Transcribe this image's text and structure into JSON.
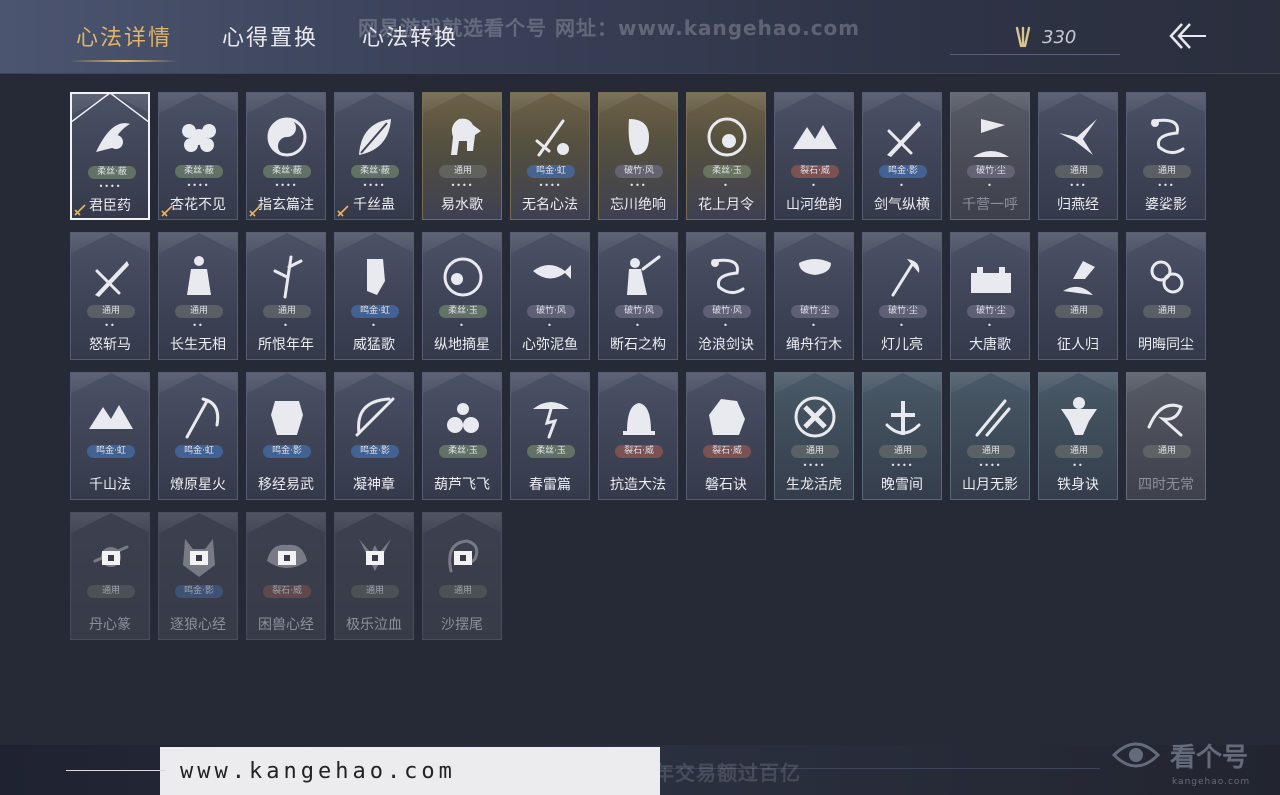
{
  "tabs": [
    {
      "label": "心法详情",
      "active": true
    },
    {
      "label": "心得置换",
      "active": false
    },
    {
      "label": "心法转换",
      "active": false
    }
  ],
  "watermark_top": "网易游戏就选看个号 网址：www.kangehao.com",
  "currency": {
    "icon": "feather-icon",
    "value": "330"
  },
  "back_icon": "back-arrow-icon",
  "cards": [
    {
      "name": "君臣药",
      "tag": "柔丝·蔽",
      "tagClass": "t-roufu",
      "dots": "••••",
      "style": "",
      "selected": true,
      "corner": true,
      "icon": "herb-icon"
    },
    {
      "name": "杏花不见",
      "tag": "柔丝·蔽",
      "tagClass": "t-roufu",
      "dots": "••••",
      "style": "",
      "corner": true,
      "icon": "blossom-icon"
    },
    {
      "name": "指玄篇注",
      "tag": "柔丝·蔽",
      "tagClass": "t-roufu",
      "dots": "••••",
      "style": "",
      "corner": true,
      "icon": "yinyang-icon"
    },
    {
      "name": "千丝蛊",
      "tag": "柔丝·蔽",
      "tagClass": "t-roufu",
      "dots": "••••",
      "style": "",
      "corner": true,
      "icon": "leaf-icon"
    },
    {
      "name": "易水歌",
      "tag": "通用",
      "tagClass": "t-tongyong",
      "dots": "••••",
      "style": "gold",
      "icon": "horse-icon"
    },
    {
      "name": "无名心法",
      "tag": "鸣金·虹",
      "tagClass": "t-mingjin",
      "dots": "••••",
      "style": "gold",
      "icon": "sword-icon"
    },
    {
      "name": "忘川绝响",
      "tag": "破竹·风",
      "tagClass": "t-xuanzhu",
      "dots": "•••",
      "style": "gold",
      "icon": "mask-icon"
    },
    {
      "name": "花上月令",
      "tag": "柔丝·玉",
      "tagClass": "t-roufu",
      "dots": "•",
      "style": "gold",
      "icon": "moon-flower-icon"
    },
    {
      "name": "山河绝韵",
      "tag": "裂石·威",
      "tagClass": "t-lieshi",
      "dots": "•",
      "style": "",
      "icon": "mountain-icon"
    },
    {
      "name": "剑气纵横",
      "tag": "鸣金·影",
      "tagClass": "t-mingjin",
      "dots": "•",
      "style": "",
      "icon": "blade-icon"
    },
    {
      "name": "千营一呼",
      "tag": "破竹·尘",
      "tagClass": "t-xuanzhu",
      "dots": "•",
      "style": "gray",
      "icon": "flag-icon"
    },
    {
      "name": "归燕经",
      "tag": "通用",
      "tagClass": "t-tongyong",
      "dots": "•••",
      "style": "",
      "icon": "swallow-icon"
    },
    {
      "name": "婆娑影",
      "tag": "通用",
      "tagClass": "t-tongyong",
      "dots": "•••",
      "style": "",
      "icon": "dragon-icon"
    },
    {
      "name": "怒斩马",
      "tag": "通用",
      "tagClass": "t-tongyong",
      "dots": "••",
      "style": "",
      "icon": "blade-icon"
    },
    {
      "name": "长生无相",
      "tag": "通用",
      "tagClass": "t-tongyong",
      "dots": "••",
      "style": "",
      "icon": "figure-icon"
    },
    {
      "name": "所恨年年",
      "tag": "通用",
      "tagClass": "t-tongyong",
      "dots": "•",
      "style": "",
      "icon": "bamboo-icon"
    },
    {
      "name": "威猛歌",
      "tag": "鸣金·虹",
      "tagClass": "t-mingjin",
      "dots": "•",
      "style": "",
      "icon": "fist-icon"
    },
    {
      "name": "纵地摘星",
      "tag": "柔丝·玉",
      "tagClass": "t-roufu",
      "dots": "•",
      "style": "",
      "icon": "orbit-icon"
    },
    {
      "name": "心弥泥鱼",
      "tag": "破竹·风",
      "tagClass": "t-xuanzhu",
      "dots": "•",
      "style": "",
      "icon": "fish-icon"
    },
    {
      "name": "断石之构",
      "tag": "破竹·风",
      "tagClass": "t-xuanzhu",
      "dots": "•",
      "style": "",
      "icon": "warrior-icon"
    },
    {
      "name": "沧浪剑诀",
      "tag": "破竹·风",
      "tagClass": "t-xuanzhu",
      "dots": "•",
      "style": "",
      "icon": "dragon-icon"
    },
    {
      "name": "绳舟行木",
      "tag": "破竹·尘",
      "tagClass": "t-xuanzhu",
      "dots": "•",
      "style": "",
      "icon": "tree-icon"
    },
    {
      "name": "灯儿亮",
      "tag": "破竹·尘",
      "tagClass": "t-xuanzhu",
      "dots": "•",
      "style": "",
      "icon": "axe-icon"
    },
    {
      "name": "大唐歌",
      "tag": "破竹·尘",
      "tagClass": "t-xuanzhu",
      "dots": "•",
      "style": "",
      "icon": "castle-icon"
    },
    {
      "name": "征人归",
      "tag": "通用",
      "tagClass": "t-tongyong",
      "dots": "",
      "style": "",
      "icon": "bird-hand-icon"
    },
    {
      "name": "明晦同尘",
      "tag": "通用",
      "tagClass": "t-tongyong",
      "dots": "",
      "style": "",
      "icon": "knot-icon"
    },
    {
      "name": "千山法",
      "tag": "鸣金·虹",
      "tagClass": "t-mingjin",
      "dots": "",
      "style": "",
      "icon": "mountain-icon"
    },
    {
      "name": "燎原星火",
      "tag": "鸣金·虹",
      "tagClass": "t-mingjin",
      "dots": "",
      "style": "",
      "icon": "scythe-icon"
    },
    {
      "name": "移经易武",
      "tag": "鸣金·影",
      "tagClass": "t-mingjin",
      "dots": "",
      "style": "",
      "icon": "armor-icon"
    },
    {
      "name": "凝神章",
      "tag": "鸣金·影",
      "tagClass": "t-mingjin",
      "dots": "",
      "style": "",
      "icon": "bow-icon"
    },
    {
      "name": "葫芦飞飞",
      "tag": "柔丝·玉",
      "tagClass": "t-roufu",
      "dots": "",
      "style": "",
      "icon": "gourd-icon"
    },
    {
      "name": "春雷篇",
      "tag": "柔丝·玉",
      "tagClass": "t-roufu",
      "dots": "",
      "style": "",
      "icon": "storm-icon"
    },
    {
      "name": "抗造大法",
      "tag": "裂石·威",
      "tagClass": "t-lieshi",
      "dots": "",
      "style": "",
      "icon": "bell-icon"
    },
    {
      "name": "磐石诀",
      "tag": "裂石·威",
      "tagClass": "t-lieshi",
      "dots": "",
      "style": "",
      "icon": "rock-icon"
    },
    {
      "name": "生龙活虎",
      "tag": "通用",
      "tagClass": "t-tongyong",
      "dots": "••••",
      "style": "teal",
      "icon": "pinwheel-icon"
    },
    {
      "name": "晚雪间",
      "tag": "通用",
      "tagClass": "t-tongyong",
      "dots": "••••",
      "style": "teal",
      "icon": "cross-icon"
    },
    {
      "name": "山月无影",
      "tag": "通用",
      "tagClass": "t-tongyong",
      "dots": "••••",
      "style": "teal",
      "icon": "slash-icon"
    },
    {
      "name": "铁身诀",
      "tag": "通用",
      "tagClass": "t-tongyong",
      "dots": "••",
      "style": "teal",
      "icon": "muscle-icon"
    },
    {
      "name": "四时无常",
      "tag": "通用",
      "tagClass": "t-tongyong",
      "dots": "",
      "style": "gray",
      "icon": "spiral-icon"
    },
    {
      "name": "丹心篆",
      "tag": "通用",
      "tagClass": "t-tongyong",
      "dots": "",
      "style": "locked",
      "lock": true,
      "icon": "seal-icon"
    },
    {
      "name": "逐狼心经",
      "tag": "鸣金·影",
      "tagClass": "t-mingjin",
      "dots": "",
      "style": "locked",
      "lock": true,
      "icon": "wolf-icon"
    },
    {
      "name": "困兽心经",
      "tag": "裂石·威",
      "tagClass": "t-lieshi",
      "dots": "",
      "style": "locked",
      "lock": true,
      "icon": "beast-icon"
    },
    {
      "name": "极乐泣血",
      "tag": "通用",
      "tagClass": "t-tongyong",
      "dots": "",
      "style": "locked",
      "lock": true,
      "icon": "wing-icon"
    },
    {
      "name": "沙摆尾",
      "tag": "通用",
      "tagClass": "t-tongyong",
      "dots": "",
      "style": "locked",
      "lock": true,
      "icon": "swirl-icon"
    }
  ],
  "footer": {
    "url": "www.kangehao.com",
    "watermark": "看个号专业网易游戏八年 年交易额过百亿",
    "brand": "看个号",
    "brand_small": "kangehao.com"
  }
}
